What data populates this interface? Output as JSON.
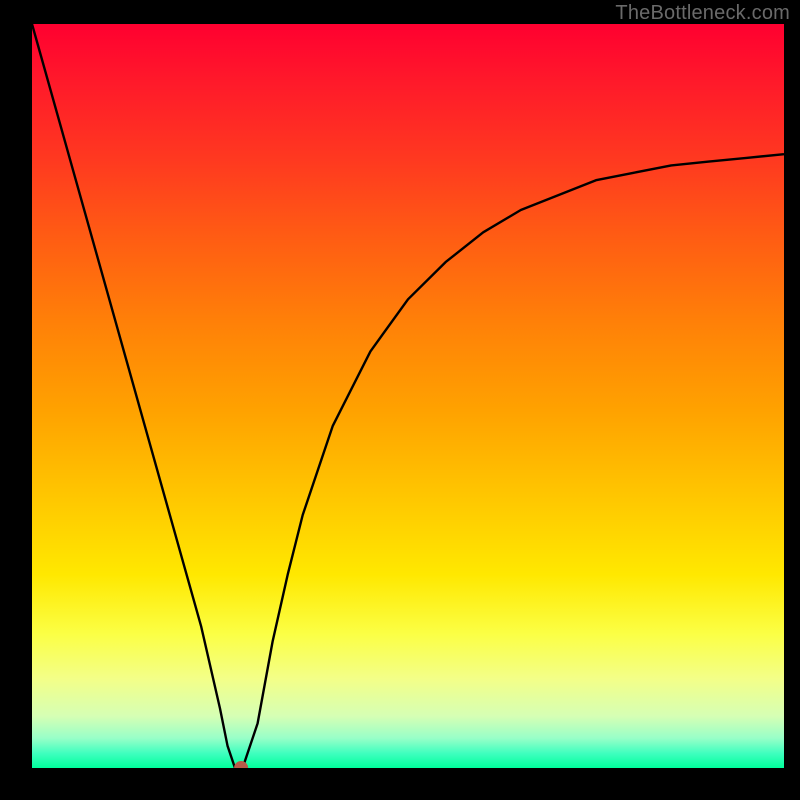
{
  "watermark": "TheBottleneck.com",
  "chart_data": {
    "type": "line",
    "title": "",
    "xlabel": "",
    "ylabel": "",
    "xlim": [
      0,
      1
    ],
    "ylim": [
      0,
      1
    ],
    "grid": false,
    "legend": false,
    "background_gradient": {
      "orientation": "vertical",
      "stops": [
        {
          "pos": 0.0,
          "color": "#ff0030"
        },
        {
          "pos": 0.5,
          "color": "#ffa200"
        },
        {
          "pos": 0.8,
          "color": "#ffe800"
        },
        {
          "pos": 0.95,
          "color": "#98ffc8"
        },
        {
          "pos": 1.0,
          "color": "#00ff9c"
        }
      ]
    },
    "series": [
      {
        "name": "bottleneck-curve",
        "color": "#000000",
        "x": [
          0.0,
          0.05,
          0.1,
          0.15,
          0.2,
          0.225,
          0.25,
          0.26,
          0.27,
          0.28,
          0.3,
          0.32,
          0.34,
          0.36,
          0.4,
          0.45,
          0.5,
          0.55,
          0.6,
          0.65,
          0.7,
          0.75,
          0.8,
          0.85,
          0.9,
          0.95,
          1.0
        ],
        "y": [
          1.0,
          0.82,
          0.64,
          0.46,
          0.28,
          0.19,
          0.08,
          0.03,
          0.0,
          0.0,
          0.06,
          0.17,
          0.26,
          0.34,
          0.46,
          0.56,
          0.63,
          0.68,
          0.72,
          0.75,
          0.77,
          0.79,
          0.8,
          0.81,
          0.815,
          0.82,
          0.825
        ]
      }
    ],
    "marker": {
      "name": "min-point",
      "x": 0.278,
      "y": 0.0,
      "color": "#b85a4a",
      "radius_px": 7
    }
  }
}
